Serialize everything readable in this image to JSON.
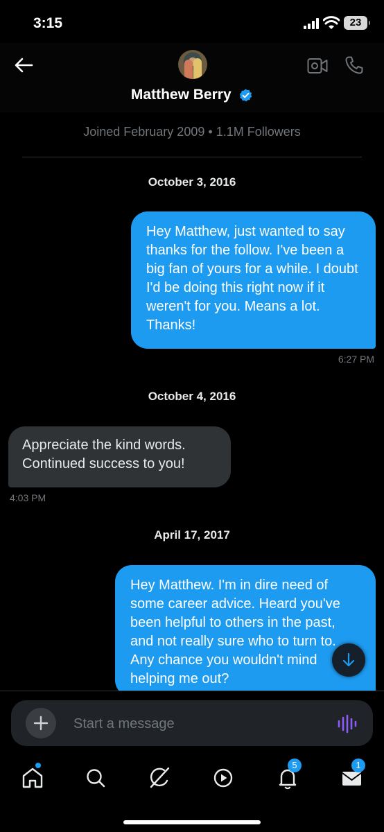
{
  "status_bar": {
    "time": "3:15",
    "battery": "23"
  },
  "header": {
    "name": "Matthew Berry"
  },
  "profile_meta": {
    "joined": "Joined February 2009",
    "separator": "•",
    "followers": "1.1M Followers"
  },
  "conversation": [
    {
      "type": "date",
      "text": "October 3, 2016"
    },
    {
      "type": "sent",
      "text": "Hey Matthew, just wanted to say thanks for the follow. I've been a big fan of yours for a while. I doubt I'd be doing this right now if it weren't for you. Means a lot. Thanks!",
      "time": "6:27 PM"
    },
    {
      "type": "date",
      "text": "October 4, 2016"
    },
    {
      "type": "received",
      "text": "Appreciate the kind words. Continued success to you!",
      "time": "4:03 PM"
    },
    {
      "type": "date",
      "text": "April 17, 2017"
    },
    {
      "type": "sent",
      "text": "Hey Matthew. I'm in dire need of some career advice. Heard you've been helpful to others in the past, and not really sure who to turn to. Any chance you wouldn't mind helping me out?"
    }
  ],
  "composer": {
    "placeholder": "Start a message"
  },
  "nav": {
    "items": [
      {
        "icon": "home-icon",
        "dot": true
      },
      {
        "icon": "search-icon"
      },
      {
        "icon": "grok-icon"
      },
      {
        "icon": "video-play-icon"
      },
      {
        "icon": "bell-icon",
        "badge": "5"
      },
      {
        "icon": "mail-icon",
        "badge": "1"
      }
    ]
  },
  "colors": {
    "accent": "#1d9bf0",
    "received_bubble": "#2f3336",
    "background": "#000000",
    "muted": "#71767b",
    "voice": "#8b5cf6"
  }
}
